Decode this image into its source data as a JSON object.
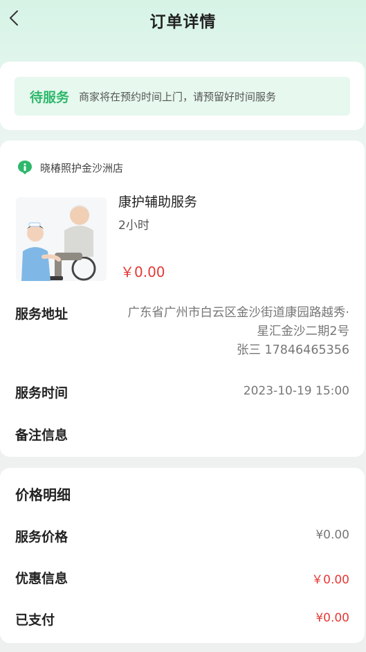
{
  "header": {
    "title": "订单详情",
    "back_icon": "chevron-left-icon"
  },
  "status": {
    "label": "待服务",
    "description": "商家将在预约时间上门，请预留好时间服务",
    "color": "#2db86b"
  },
  "order": {
    "shop_icon": "store-location-icon",
    "shop_name": "晓椿照护金沙洲店",
    "service_name": "康护辅助服务",
    "duration": "2小时",
    "price": "￥0.00",
    "address_label": "服务地址",
    "address_line1": "广东省广州市白云区金沙街道康园路越秀·",
    "address_line2": "星汇金沙二期2号",
    "contact": "张三 17846465356",
    "time_label": "服务时间",
    "time_value": "2023-10-19 15:00",
    "remark_label": "备注信息",
    "remark_value": ""
  },
  "price_detail": {
    "title": "价格明细",
    "rows": [
      {
        "label": "服务价格",
        "value": "¥0.00"
      },
      {
        "label": "优惠信息",
        "value": "￥0.00"
      },
      {
        "label": "已支付",
        "value": "¥0.00"
      }
    ]
  },
  "colors": {
    "accent_green": "#2db86b",
    "price_red": "#e53935",
    "background_mint": "#d6f3e6"
  }
}
